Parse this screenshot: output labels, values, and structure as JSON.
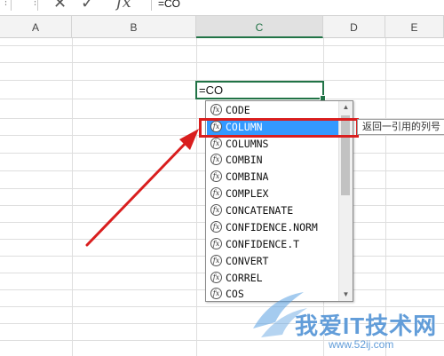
{
  "formula_bar": {
    "menu_dots": "⋮",
    "dots2": "⋮",
    "cancel_icon": "✕",
    "enter_icon": "✓",
    "fx_icon": "fx",
    "formula_text": "=CO"
  },
  "columns": [
    "A",
    "B",
    "C",
    "D",
    "E"
  ],
  "active_cell": {
    "column": "C",
    "value": "=CO"
  },
  "autocomplete": {
    "icon_glyph": "fx",
    "items": [
      {
        "label": "CODE",
        "selected": false
      },
      {
        "label": "COLUMN",
        "selected": true
      },
      {
        "label": "COLUMNS",
        "selected": false
      },
      {
        "label": "COMBIN",
        "selected": false
      },
      {
        "label": "COMBINA",
        "selected": false
      },
      {
        "label": "COMPLEX",
        "selected": false
      },
      {
        "label": "CONCATENATE",
        "selected": false
      },
      {
        "label": "CONFIDENCE.NORM",
        "selected": false
      },
      {
        "label": "CONFIDENCE.T",
        "selected": false
      },
      {
        "label": "CONVERT",
        "selected": false
      },
      {
        "label": "CORREL",
        "selected": false
      },
      {
        "label": "COS",
        "selected": false
      }
    ],
    "scroll_up": "▲",
    "scroll_down": "▼"
  },
  "tooltip": {
    "text": "返回一引用的列号"
  },
  "colors": {
    "selection_blue": "#3399ff",
    "excel_green": "#217346",
    "annotation_red": "#d91e1e"
  },
  "watermark": {
    "title": "我爱IT技术网",
    "url": "www.52ij.com"
  }
}
